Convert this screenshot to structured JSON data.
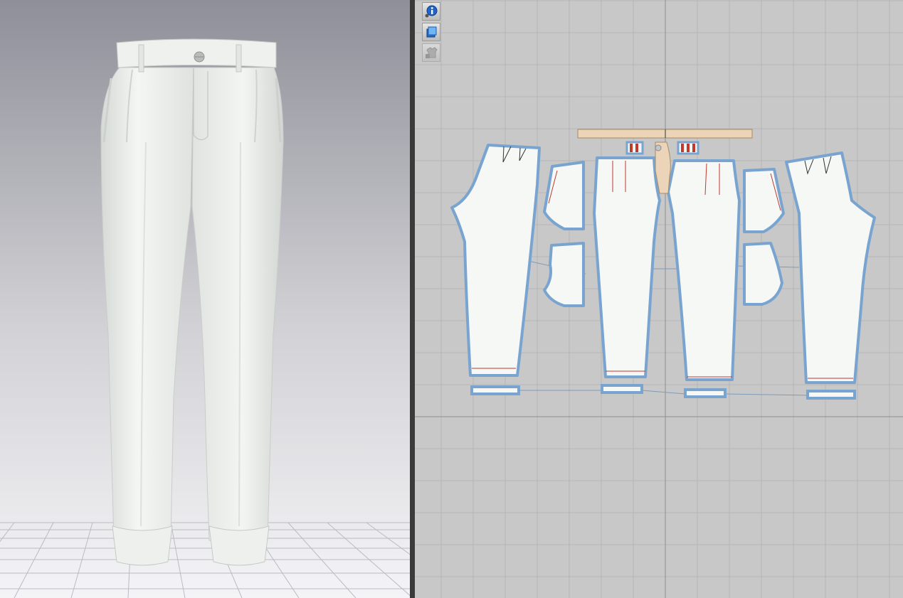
{
  "app": {
    "views": [
      "3d-avatar-view",
      "2d-pattern-view"
    ]
  },
  "toolbar": {
    "tools": [
      {
        "icon": "info-icon",
        "active": true
      },
      {
        "icon": "texture-layer-icon",
        "active": true
      },
      {
        "icon": "locked-garment-icon",
        "active": false
      }
    ]
  },
  "colors": {
    "viewport3d_top": "#8f8f99",
    "viewport3d_bottom": "#f4f4f6",
    "garment_fabric": "#e9ece9",
    "viewport2d_bg": "#c8c8c8",
    "grid_line": "#b6b6b6",
    "piece_fill": "#f6f8f6",
    "piece_outline": "#7aa4d0",
    "waistband_fill": "#ecd4b8",
    "sewing_line": "#7f9bb8",
    "notch_red": "#c0392b"
  },
  "scene": {
    "garment": "trousers",
    "pattern_pieces": [
      "left-back-leg",
      "left-back-pocket-upper",
      "left-back-pocket-lower",
      "left-front-leg",
      "right-front-leg",
      "right-back-pocket-upper",
      "right-back-pocket-lower",
      "right-back-leg",
      "waistband",
      "fly-facing",
      "belt-loops-left",
      "belt-loops-right",
      "cuff-1",
      "cuff-2",
      "cuff-3",
      "cuff-4"
    ]
  }
}
